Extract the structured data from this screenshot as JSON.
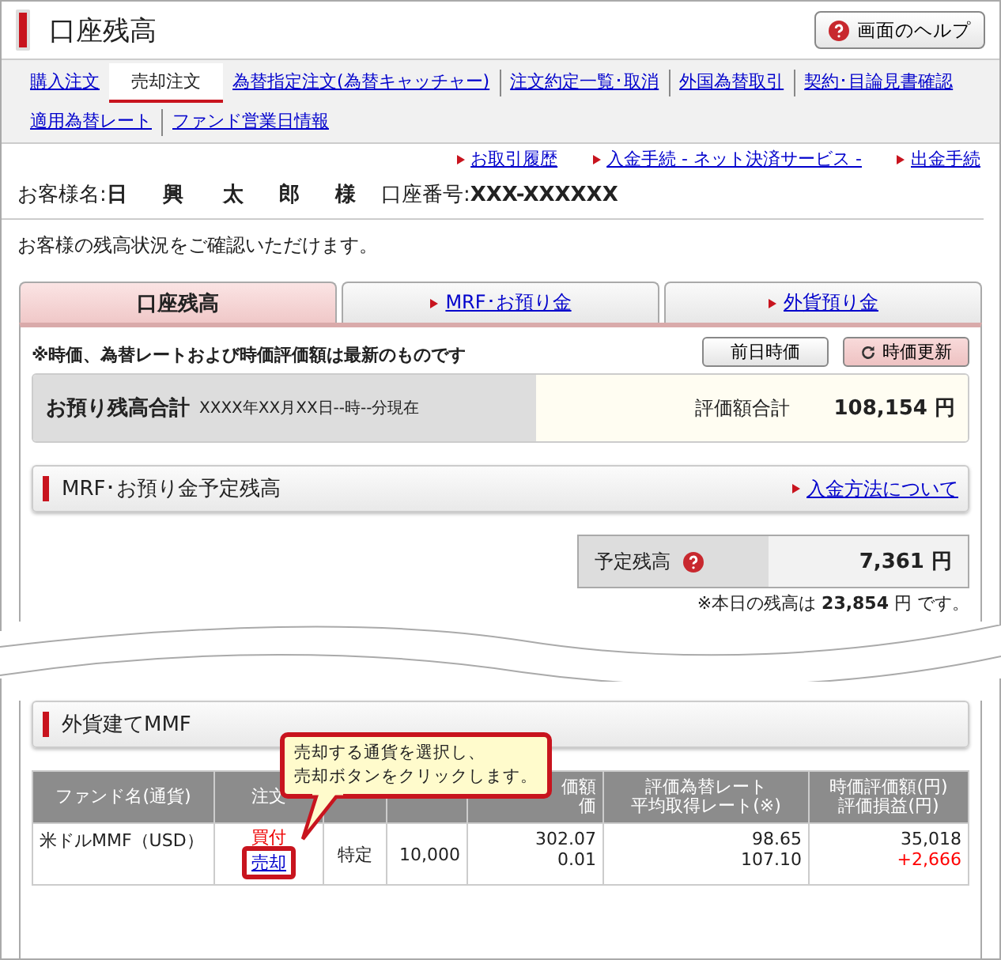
{
  "header": {
    "title": "口座残高",
    "help_button": "画面のヘルプ"
  },
  "nav_tabs": [
    {
      "label": "購入注文",
      "selected": false
    },
    {
      "label": "売却注文",
      "selected": true
    },
    {
      "label": "為替指定注文(為替キャッチャー)",
      "selected": false
    },
    {
      "label": "注文約定一覧･取消",
      "selected": false
    },
    {
      "label": "外国為替取引",
      "selected": false
    },
    {
      "label": "契約･目論見書確認",
      "selected": false
    },
    {
      "label": "適用為替レート",
      "selected": false
    },
    {
      "label": "ファンド営業日情報",
      "selected": false
    }
  ],
  "quick_links": [
    "お取引履歴",
    "入金手続 - ネット決済サービス -",
    "出金手続"
  ],
  "customer": {
    "name_label": "お客様名:",
    "name": "日 興　太 郎 様",
    "account_label": "口座番号:",
    "account": "XXX-XXXXXX"
  },
  "intro": "お客様の残高状況をご確認いただけます。",
  "section_tabs": [
    {
      "label": "口座残高",
      "selected": true
    },
    {
      "label": "MRF･お預り金",
      "selected": false
    },
    {
      "label": "外貨預り金",
      "selected": false
    }
  ],
  "notice": "※時価、為替レートおよび時価評価額は最新のものです",
  "buttons": [
    {
      "label": "前日時価",
      "kind": "plain"
    },
    {
      "label": "時価更新",
      "kind": "refresh"
    }
  ],
  "total": {
    "title": "お預り残高合計",
    "as_of": "XXXX年XX月XX日--時--分現在",
    "label": "評価額合計",
    "value": "108,154 円"
  },
  "mrf": {
    "title": "MRF･お預り金予定残高",
    "link": "入金方法について",
    "label": "予定残高",
    "value": "7,361 円",
    "note": "※本日の残高は **23,854** 円 です。"
  },
  "mmf": {
    "title": "外貨建てMMF",
    "columns": [
      {
        "lines": [
          "ファンド名(通貨)"
        ]
      },
      {
        "lines": [
          "注文"
        ]
      },
      {},
      {},
      {
        "lines": [
          "価額",
          "価"
        ]
      },
      {
        "lines": [
          "評価為替レート",
          "平均取得レート(※)"
        ]
      },
      {
        "lines": [
          "時価評価額(円)",
          "評価損益(円)"
        ]
      }
    ],
    "rows": [
      {
        "fund": "米ドルMMF（USD）",
        "buy": "買付",
        "sell": "売却",
        "account": "特定",
        "quantity": "10,000",
        "price": [
          "302.07",
          "0.01"
        ],
        "rate": [
          "98.65",
          "107.10"
        ],
        "valuation": "35,018",
        "profit": "+2,666"
      }
    ],
    "callout": [
      "売却する通貨を選択し、",
      "売却ボタンをクリックします。"
    ]
  }
}
